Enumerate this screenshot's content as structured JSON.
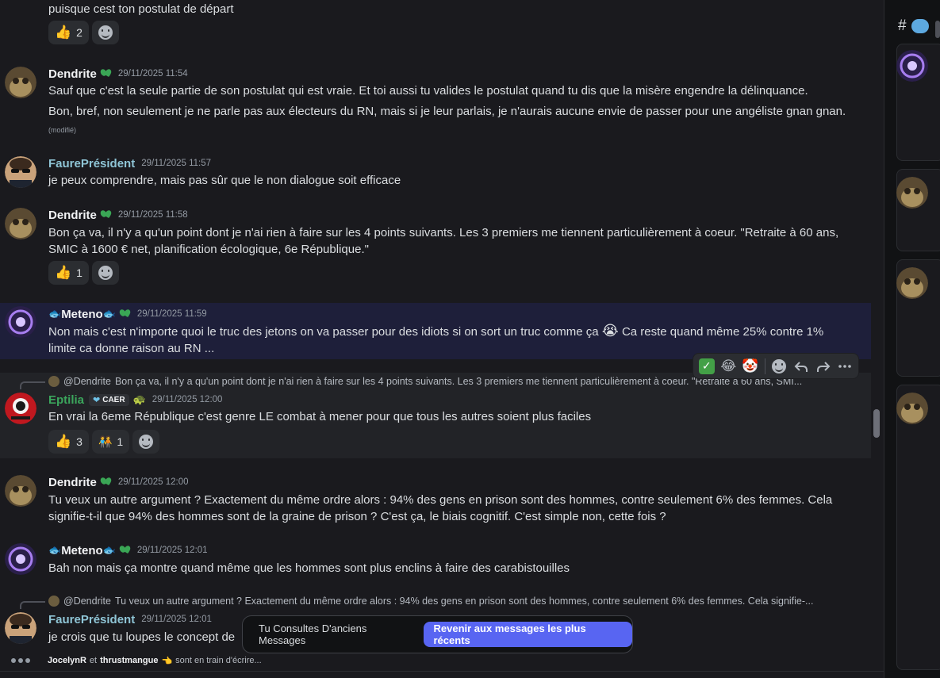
{
  "messages": {
    "m0": {
      "text": "puisque cest ton postulat de départ",
      "reactions": [
        {
          "emoji": "👍",
          "count": "2"
        }
      ]
    },
    "m1": {
      "author": "Dendrite",
      "ts": "29/11/2025 11:54",
      "line1": "Sauf que c'est la seule partie de son postulat qui est vraie. Et toi aussi tu valides le postulat quand tu dis que la misère engendre la délinquance.",
      "line2": "Bon, bref, non seulement je ne parle pas aux électeurs du RN, mais si je leur parlais, je n'aurais aucune envie de passer pour une angéliste gnan gnan.",
      "edited": "(modifié)"
    },
    "m2": {
      "author": "FaurePrésident",
      "ts": "29/11/2025 11:57",
      "line1": "je peux comprendre, mais pas sûr que le non dialogue soit efficace"
    },
    "m3": {
      "author": "Dendrite",
      "ts": "29/11/2025 11:58",
      "line1": "Bon ça va, il n'y a qu'un point dont je n'ai rien à faire sur les 4 points suivants. Les 3 premiers me tiennent particulièrement à coeur. \"Retraite à 60 ans,",
      "line2": "SMIC à 1600 € net, planification écologique, 6e République.\"",
      "reactions": [
        {
          "emoji": "👍",
          "count": "1"
        }
      ]
    },
    "m4": {
      "author": "Meteno",
      "ts": "29/11/2025 11:59",
      "line1a": "Non mais c'est n'importe quoi le truc des jetons on va passer pour des idiots si on sort un truc comme ça",
      "emoji": "😭",
      "line1b": "Ca reste quand même 25% contre 1%",
      "line2": "limite ca donne raison au RN ..."
    },
    "m5": {
      "reply_name": "@Dendrite",
      "reply_text": "Bon ça va, il n'y a qu'un point dont je n'ai rien à faire sur les 4 points suivants. Les 3 premiers me tiennent particulièrement à coeur. \"Retraite à 60 ans, SMI...",
      "author": "Eptilia",
      "tag": "CAER",
      "ts": "29/11/2025 12:00",
      "line1": "En vrai la 6eme République c'est genre LE combat à mener pour que tous les autres soient plus faciles",
      "reactions": [
        {
          "emoji": "👍",
          "count": "3"
        },
        {
          "emoji": "🧑‍🤝‍🧑",
          "count": "1"
        }
      ]
    },
    "m6": {
      "author": "Dendrite",
      "ts": "29/11/2025 12:00",
      "line1": "Tu veux un autre argument ? Exactement du même ordre alors : 94% des gens en prison sont des hommes, contre seulement 6% des femmes. Cela",
      "line2": "signifie-t-il que 94% des hommes sont de la graine de prison ? C'est  ça, le biais cognitif. C'est simple non, cette fois ?"
    },
    "m7": {
      "author": "Meteno",
      "ts": "29/11/2025 12:01",
      "line1": "Bah non mais ça montre quand même que les hommes sont plus enclins à faire des carabistouilles"
    },
    "m8": {
      "reply_name": "@Dendrite",
      "reply_text": "Tu veux un autre argument ? Exactement du même ordre alors : 94% des gens en prison sont des hommes, contre seulement 6% des femmes. Cela signifie-...",
      "author": "FaurePrésident",
      "ts": "29/11/2025 12:01",
      "line1": "je crois que tu loupes le concept de"
    }
  },
  "toolbar": {
    "emojis": [
      "✅",
      "😂",
      "🤡"
    ],
    "icons": [
      "add-reaction-icon",
      "reply-icon",
      "forward-icon",
      "more-icon"
    ]
  },
  "jump": {
    "text": "Tu Consultes D'anciens Messages",
    "button": "Revenir aux messages les plus récents"
  },
  "typing": {
    "user1": "JocelynR",
    "sep": "et",
    "user2": "thrustmangue",
    "emoji": "👈",
    "suffix": "sont en train d'écrire..."
  },
  "sidepanel": {
    "hash": "#"
  },
  "colors": {
    "accent": "#5865f2",
    "highlight": "#1e1f3a",
    "eptilia": "#3ba55c"
  }
}
